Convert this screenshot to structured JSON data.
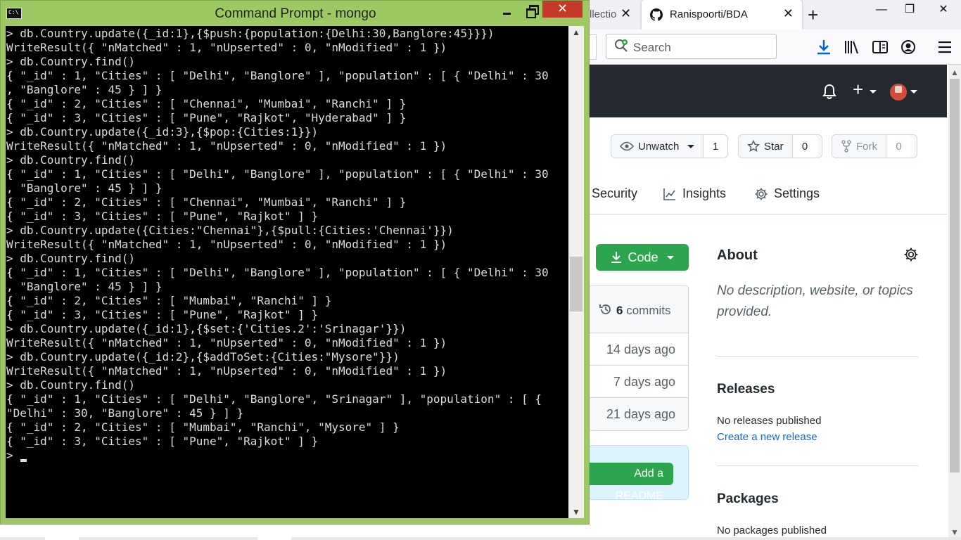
{
  "browser": {
    "tabs": [
      {
        "title": "llectio",
        "active": false
      },
      {
        "title": "Ranispoorti/BDA",
        "active": true
      }
    ],
    "search_placeholder": "Search"
  },
  "github": {
    "watch": {
      "label": "Unwatch",
      "count": "1"
    },
    "star": {
      "label": "Star",
      "count": "0"
    },
    "fork": {
      "label": "Fork",
      "count": "0"
    },
    "nav": {
      "security": "Security",
      "insights": "Insights",
      "settings": "Settings"
    },
    "code_button": "Code",
    "commits": {
      "count": "6",
      "label": "commits"
    },
    "commit_times": [
      "14 days ago",
      "7 days ago",
      "21 days ago"
    ],
    "add_readme": "Add a README",
    "about": {
      "title": "About",
      "description": "No description, website, or topics provided."
    },
    "releases": {
      "title": "Releases",
      "text": "No releases published",
      "link": "Create a new release"
    },
    "packages": {
      "title": "Packages",
      "text": "No packages published"
    }
  },
  "cmd": {
    "title": "Command Prompt - mongo",
    "lines": [
      "> db.Country.update({_id:1},{$push:{population:{Delhi:30,Banglore:45}}})",
      "WriteResult({ \"nMatched\" : 1, \"nUpserted\" : 0, \"nModified\" : 1 })",
      "> db.Country.find()",
      "{ \"_id\" : 1, \"Cities\" : [ \"Delhi\", \"Banglore\" ], \"population\" : [ { \"Delhi\" : 30",
      ", \"Banglore\" : 45 } ] }",
      "{ \"_id\" : 2, \"Cities\" : [ \"Chennai\", \"Mumbai\", \"Ranchi\" ] }",
      "{ \"_id\" : 3, \"Cities\" : [ \"Pune\", \"Rajkot\", \"Hyderabad\" ] }",
      "> db.Country.update({_id:3},{$pop:{Cities:1}})",
      "WriteResult({ \"nMatched\" : 1, \"nUpserted\" : 0, \"nModified\" : 1 })",
      "> db.Country.find()",
      "{ \"_id\" : 1, \"Cities\" : [ \"Delhi\", \"Banglore\" ], \"population\" : [ { \"Delhi\" : 30",
      ", \"Banglore\" : 45 } ] }",
      "{ \"_id\" : 2, \"Cities\" : [ \"Chennai\", \"Mumbai\", \"Ranchi\" ] }",
      "{ \"_id\" : 3, \"Cities\" : [ \"Pune\", \"Rajkot\" ] }",
      "> db.Country.update({Cities:\"Chennai\"},{$pull:{Cities:'Chennai'}})",
      "WriteResult({ \"nMatched\" : 1, \"nUpserted\" : 0, \"nModified\" : 1 })",
      "> db.Country.find()",
      "{ \"_id\" : 1, \"Cities\" : [ \"Delhi\", \"Banglore\" ], \"population\" : [ { \"Delhi\" : 30",
      ", \"Banglore\" : 45 } ] }",
      "{ \"_id\" : 2, \"Cities\" : [ \"Mumbai\", \"Ranchi\" ] }",
      "{ \"_id\" : 3, \"Cities\" : [ \"Pune\", \"Rajkot\" ] }",
      "> db.Country.update({_id:1},{$set:{'Cities.2':'Srinagar'}})",
      "WriteResult({ \"nMatched\" : 1, \"nUpserted\" : 0, \"nModified\" : 1 })",
      "> db.Country.update({_id:2},{$addToSet:{Cities:\"Mysore\"}})",
      "WriteResult({ \"nMatched\" : 1, \"nUpserted\" : 0, \"nModified\" : 1 })",
      "> db.Country.find()",
      "{ \"_id\" : 1, \"Cities\" : [ \"Delhi\", \"Banglore\", \"Srinagar\" ], \"population\" : [ {",
      "\"Delhi\" : 30, \"Banglore\" : 45 } ] }",
      "{ \"_id\" : 2, \"Cities\" : [ \"Mumbai\", \"Ranchi\", \"Mysore\" ] }",
      "{ \"_id\" : 3, \"Cities\" : [ \"Pune\", \"Rajkot\" ] }"
    ],
    "prompt": ">"
  }
}
